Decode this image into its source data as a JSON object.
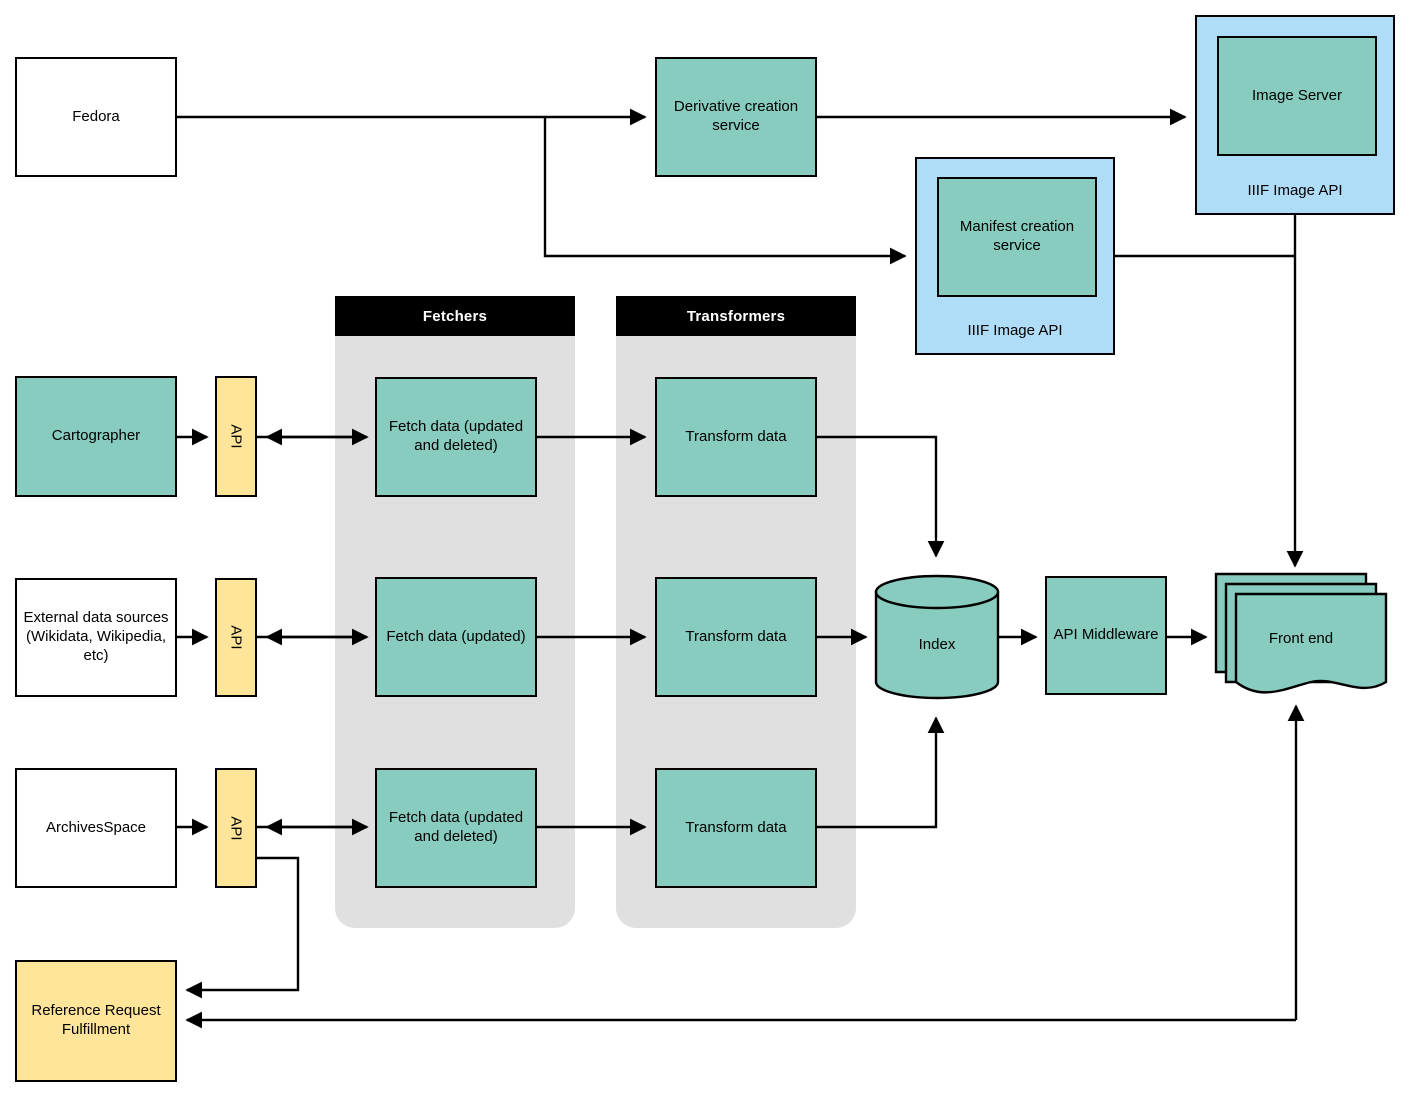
{
  "diagram": {
    "title": "Data pipeline architecture diagram",
    "colors": {
      "service_green": "#87ccbe",
      "api_yellow": "#ffe599",
      "container_blue": "#afdcf7",
      "swimlane_gray": "#e0e0e0",
      "swimlane_header": "#000000",
      "plain_white": "#ffffff",
      "stroke": "#000000"
    },
    "nodes": {
      "fedora": "Fedora",
      "derivative_creation_service": "Derivative creation service",
      "image_server": "Image Server",
      "image_server_container_label": "IIIF Image API",
      "manifest_creation_service": "Manifest creation service",
      "manifest_container_label": "IIIF Image API",
      "cartographer": "Cartographer",
      "external_data_sources": "External data sources (Wikidata, Wikipedia, etc)",
      "archivesspace": "ArchivesSpace",
      "api_cartographer": "API",
      "api_external": "API",
      "api_archivesspace": "API",
      "fetch_data_cartographer": "Fetch data (updated and deleted)",
      "fetch_data_external": "Fetch data (updated)",
      "fetch_data_archivesspace": "Fetch data (updated and deleted)",
      "transform_data_1": "Transform data",
      "transform_data_2": "Transform data",
      "transform_data_3": "Transform data",
      "index": "Index",
      "api_middleware": "API Middleware",
      "front_end": "Front end",
      "reference_request_fulfillment": "Reference Request Fulfillment"
    },
    "swimlanes": {
      "fetchers": "Fetchers",
      "transformers": "Transformers"
    }
  }
}
